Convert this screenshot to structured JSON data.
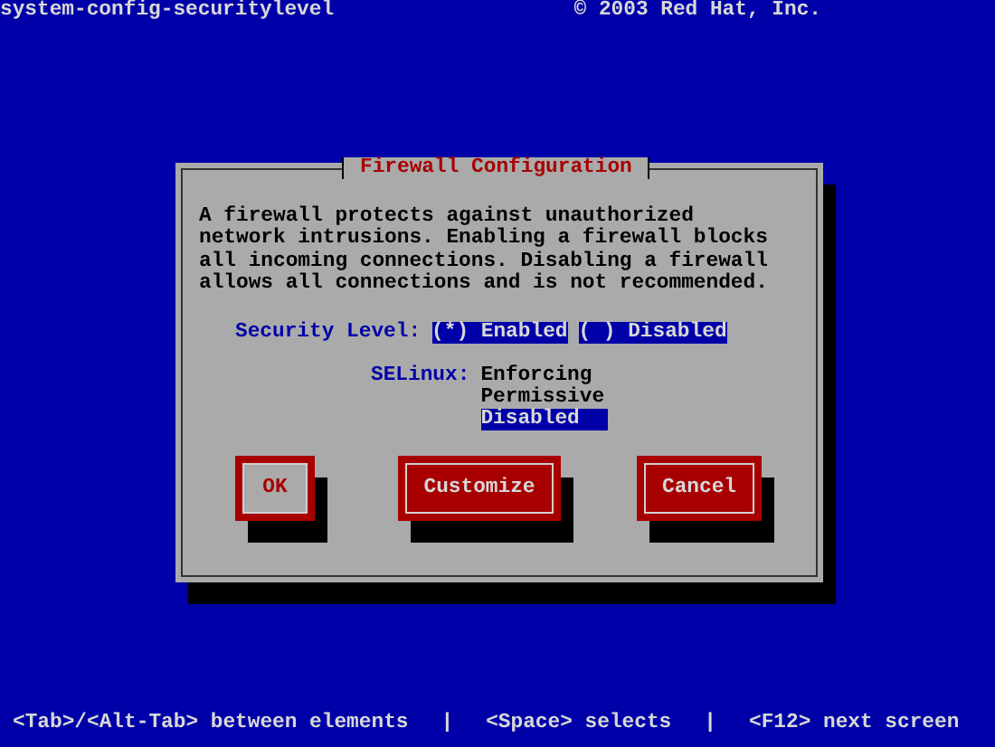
{
  "top_bar": {
    "title": "system-config-securitylevel",
    "copyright": "© 2003 Red Hat, Inc."
  },
  "dialog": {
    "title": "Firewall Configuration",
    "description": "A firewall protects against unauthorized\nnetwork intrusions. Enabling a firewall blocks\nall incoming connections. Disabling a firewall\nallows all connections and is not recommended.",
    "security_level": {
      "label": "Security Level:",
      "options": [
        {
          "label": "(*) Enabled"
        },
        {
          "label": "( ) Disabled"
        }
      ]
    },
    "selinux": {
      "label": "SELinux:",
      "options": [
        {
          "label": "Enforcing",
          "selected": false
        },
        {
          "label": "Permissive",
          "selected": false
        },
        {
          "label": "Disabled",
          "selected": true
        }
      ]
    },
    "buttons": [
      {
        "label": "OK",
        "focused": true
      },
      {
        "label": "Customize",
        "focused": false
      },
      {
        "label": "Cancel",
        "focused": false
      }
    ]
  },
  "status_bar": [
    {
      "kind": "hint",
      "text": "<Tab>/<Alt-Tab> between elements"
    },
    {
      "kind": "separator",
      "text": "|"
    },
    {
      "kind": "hint",
      "text": "<Space> selects"
    },
    {
      "kind": "separator",
      "text": "|"
    },
    {
      "kind": "hint",
      "text": "<F12> next screen"
    }
  ]
}
